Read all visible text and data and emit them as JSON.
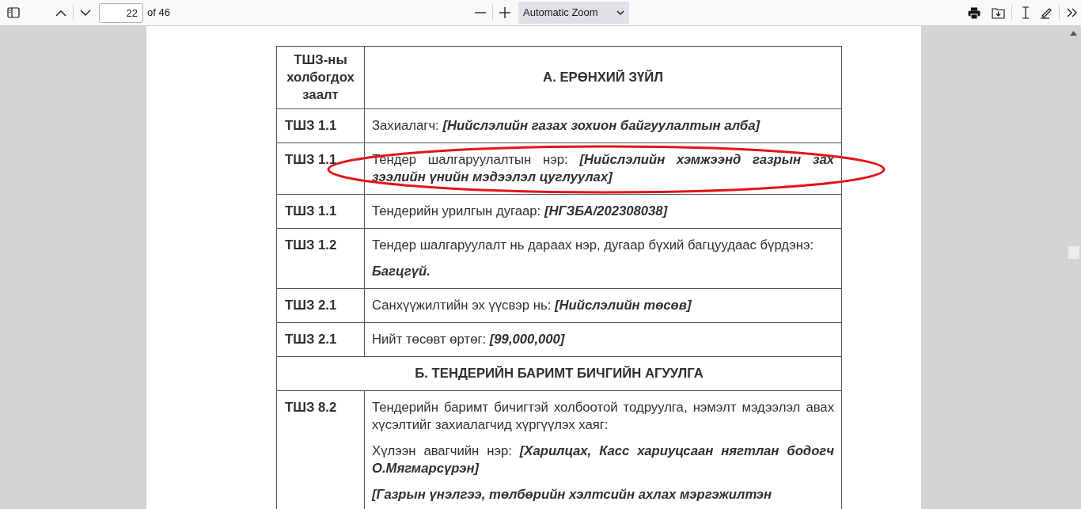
{
  "toolbar": {
    "page_number": "22",
    "page_count": "of 46",
    "zoom": "Automatic Zoom"
  },
  "table": {
    "header": {
      "column_1": "ТШЗ-ны холбогдох заалт",
      "section": "А. ЕРӨНХИЙ ЗҮЙЛ"
    },
    "rows": [
      {
        "kind": "entry",
        "clause": "ТШЗ 1.1",
        "paragraphs": [
          {
            "label": "Захиалагч: ",
            "value": "[Нийслэлийн газах зохион байгуулалтын алба]"
          }
        ]
      },
      {
        "kind": "entry",
        "clause": "ТШЗ 1.1",
        "circled": true,
        "paragraphs": [
          {
            "label": "Тендер шалгаруулалтын нэр: ",
            "value": "[Нийслэлийн хэмжээнд газрын зах зээлийн үнийн мэдээлэл цуглуулах]"
          }
        ]
      },
      {
        "kind": "entry",
        "clause": "ТШЗ 1.1",
        "paragraphs": [
          {
            "label": "Тендерийн урилгын дугаар: ",
            "value": "[НГЗБА/202308038]"
          }
        ]
      },
      {
        "kind": "entry",
        "clause": "ТШЗ 1.2",
        "paragraphs": [
          {
            "label": "Тендер шалгаруулалт нь дараах нэр, дугаар бүхий багцуудаас бүрдэнэ:"
          },
          {
            "value": "Багцгүй."
          }
        ]
      },
      {
        "kind": "entry",
        "clause": "ТШЗ 2.1",
        "paragraphs": [
          {
            "label": "Санхүүжилтийн эх үүсвэр нь: ",
            "value": "[Нийслэлийн төсөв]"
          }
        ]
      },
      {
        "kind": "entry",
        "clause": "ТШЗ 2.1",
        "paragraphs": [
          {
            "label": "Нийт төсөвт өртөг: ",
            "value": "[99,000,000]"
          }
        ]
      },
      {
        "kind": "section",
        "title": "Б. ТЕНДЕРИЙН БАРИМТ БИЧГИЙН АГУУЛГА"
      },
      {
        "kind": "entry",
        "clause": "ТШЗ 8.2",
        "paragraphs": [
          {
            "label": "Тендерийн баримт бичигтэй холбоотой тодруулга, нэмэлт мэдээлэл авах хүсэлтийг захиалагчид хүргүүлэх хаяг:"
          },
          {
            "label": "Хүлээн авагчийн нэр: ",
            "value": "[Харилцах, Касс хариуцсаан нягтлан бодогч О.Мягмарсүрэн]"
          },
          {
            "value": "[Газрын үнэлгээ, төлбөрийн хэлтсийн ахлах мэргэжилтэн"
          }
        ]
      }
    ]
  }
}
